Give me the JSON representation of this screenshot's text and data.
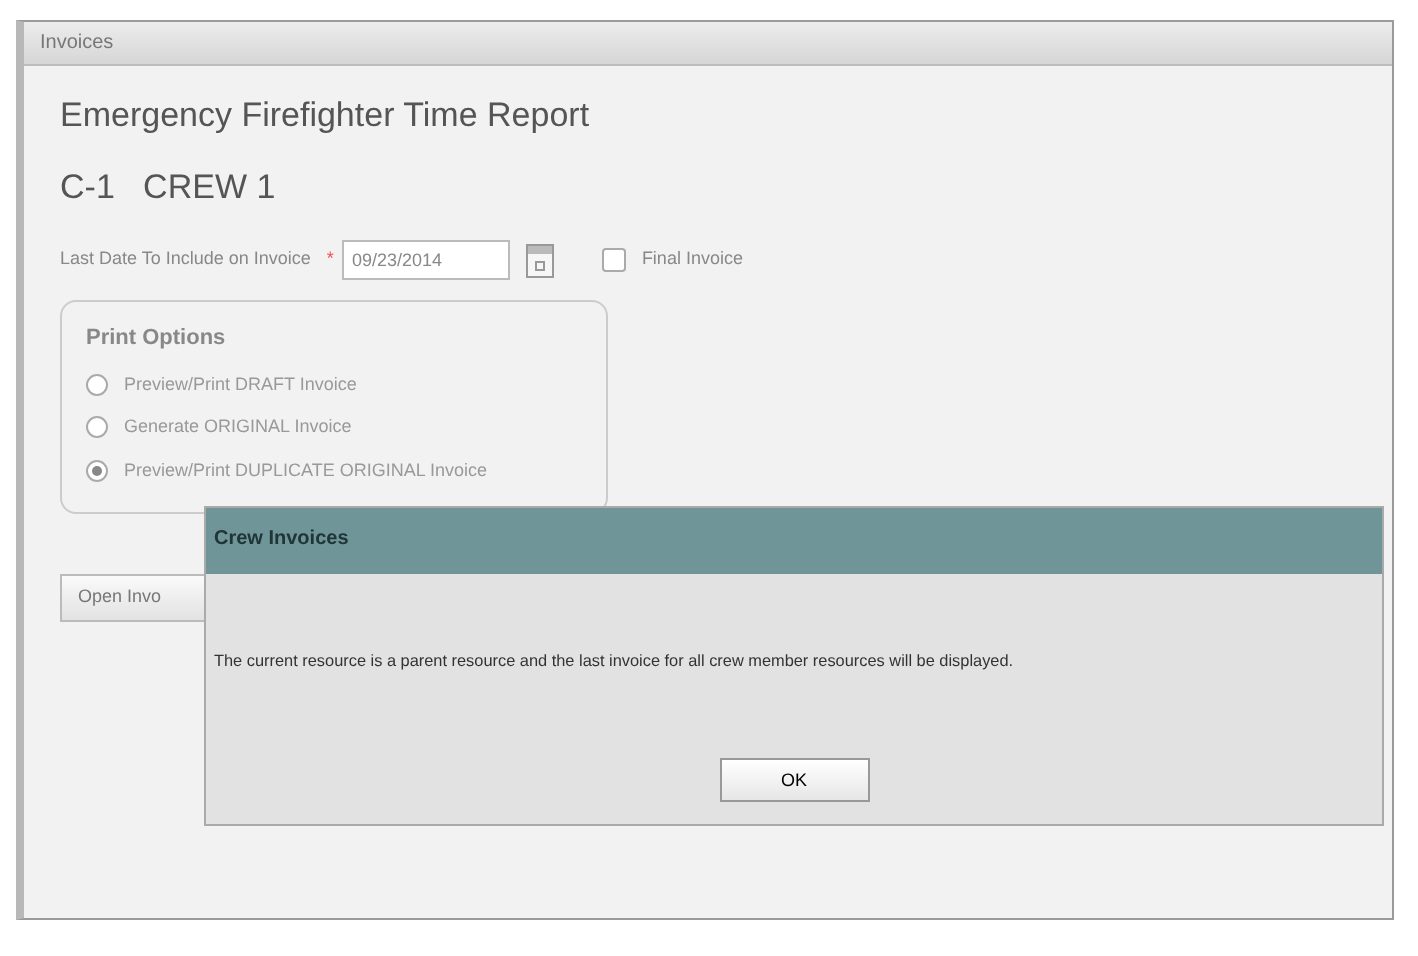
{
  "window": {
    "title": "Invoices"
  },
  "heading": "Emergency Firefighter Time Report",
  "subheading": "C-1   CREW 1",
  "date_field": {
    "label": "Last Date To Include on Invoice",
    "required_mark": "*",
    "value": "09/23/2014"
  },
  "final_invoice": {
    "label": "Final Invoice",
    "checked": false
  },
  "print_options": {
    "title": "Print Options",
    "options": [
      {
        "label": "Preview/Print DRAFT Invoice",
        "selected": false
      },
      {
        "label": "Generate ORIGINAL Invoice",
        "selected": false
      },
      {
        "label": "Preview/Print DUPLICATE ORIGINAL Invoice",
        "selected": true
      }
    ]
  },
  "open_button": "Open Invo",
  "dialog": {
    "title": "Crew Invoices",
    "message": "The current resource is a parent resource and the last invoice for all crew member resources will be displayed.",
    "button": "OK"
  }
}
